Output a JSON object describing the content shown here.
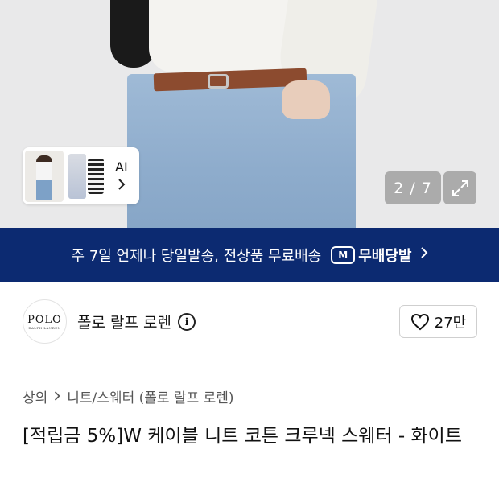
{
  "gallery": {
    "counter": "2 / 7",
    "ai_label": "AI"
  },
  "banner": {
    "text": "주 7일 언제나 당일발송, 전상품 무료배송",
    "badge": "M",
    "brand": "무배당발",
    "color": "#0c2a71"
  },
  "brand": {
    "logo_text": "POLO",
    "logo_sub": "RALPH LAUREN",
    "name": "폴로 랄프 로렌",
    "likes": "27만"
  },
  "breadcrumb": {
    "level1": "상의",
    "level2": "니트/스웨터 (폴로 랄프 로렌)"
  },
  "product": {
    "title": "[적립금 5%]W 케이블 니트 코튼 크루넥 스웨터 - 화이트"
  }
}
